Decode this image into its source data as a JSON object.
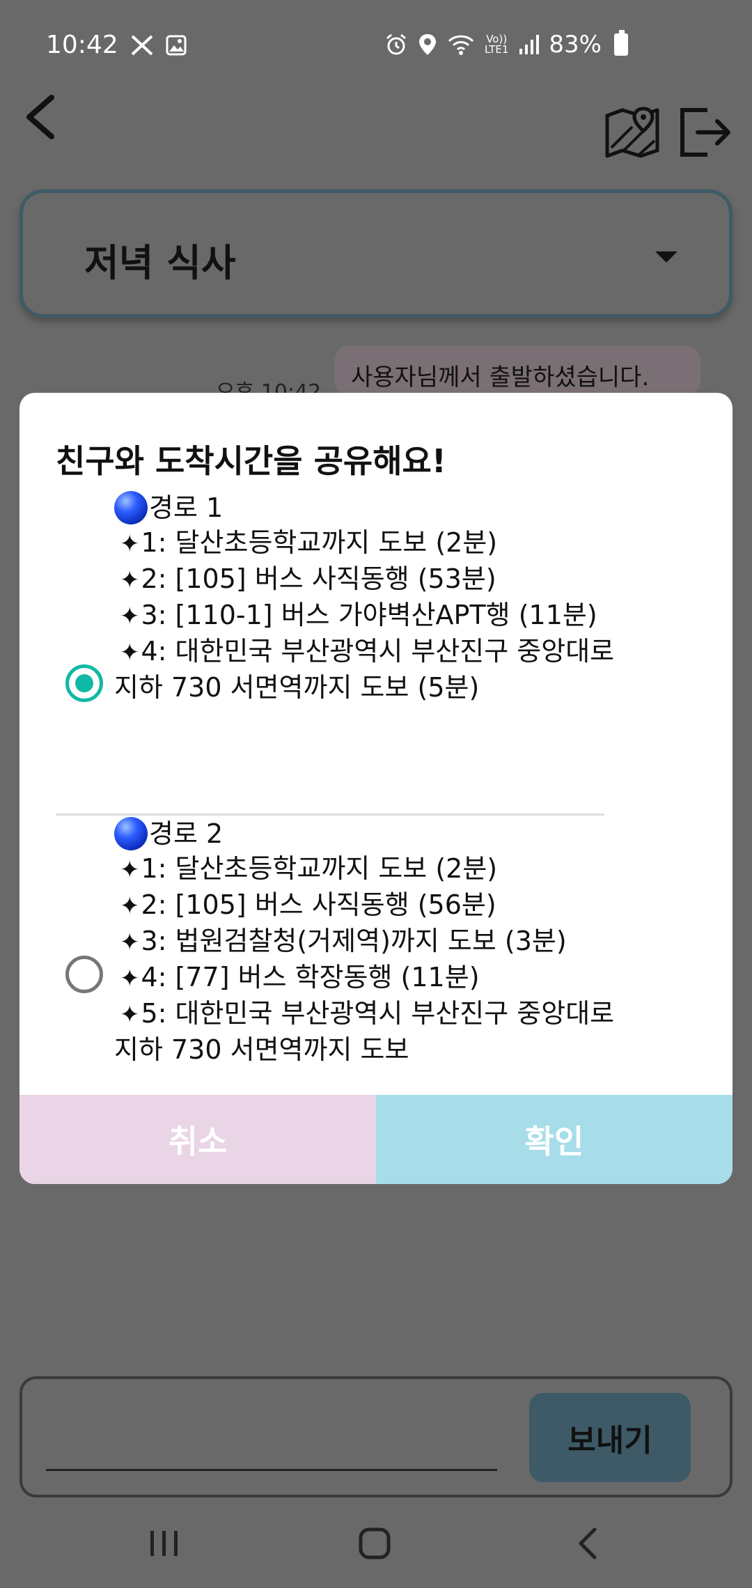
{
  "status_bar": {
    "time": "10:42",
    "notif_icons": [
      "x-logo-icon",
      "gallery-icon"
    ],
    "system_icons": [
      "alarm-icon",
      "location-icon",
      "wifi-icon",
      "volte-icon",
      "signal-icon",
      "battery-icon"
    ],
    "volte_top": "Vo))",
    "volte_bottom": "LTE1",
    "battery": "83%"
  },
  "header": {
    "icons": [
      "back-arrow-icon",
      "map-icon",
      "exit-icon"
    ]
  },
  "room_select": {
    "value": "저녁 식사"
  },
  "chat": {
    "time": "오후 10:42",
    "message": "사용자님께서 출발하셨습니다."
  },
  "dialog": {
    "title": "친구와 도착시간을 공유해요!",
    "routes": [
      {
        "name": "경로 1",
        "selected": true,
        "steps": [
          "1: 달산초등학교까지 도보 (2분)",
          "2: [105] 버스 사직동행 (53분)",
          "3: [110-1] 버스 가야벽산APT행 (11분)",
          "4: 대한민국 부산광역시 부산진구 중앙대로 지하 730 서면역까지 도보 (5분)"
        ]
      },
      {
        "name": "경로 2",
        "selected": false,
        "steps": [
          "1: 달산초등학교까지 도보 (2분)",
          "2: [105] 버스 사직동행 (56분)",
          "3: 법원검찰청(거제역)까지 도보 (3분)",
          "4: [77] 버스 학장동행 (11분)",
          "5: 대한민국 부산광역시 부산진구 중앙대로 지하 730 서면역까지 도보"
        ]
      }
    ],
    "cancel_label": "취소",
    "confirm_label": "확인"
  },
  "composer": {
    "input_value": "",
    "send_label": "보내기"
  },
  "nav_bar": {
    "icons": [
      "recents-icon",
      "home-icon",
      "back-icon"
    ]
  },
  "colors": {
    "scrim": "#696969",
    "radio_accent": "#10b9a5",
    "cancel_bg": "#e9d5e5",
    "confirm_bg": "#a7dde9",
    "send_bg": "#3d5a66"
  }
}
